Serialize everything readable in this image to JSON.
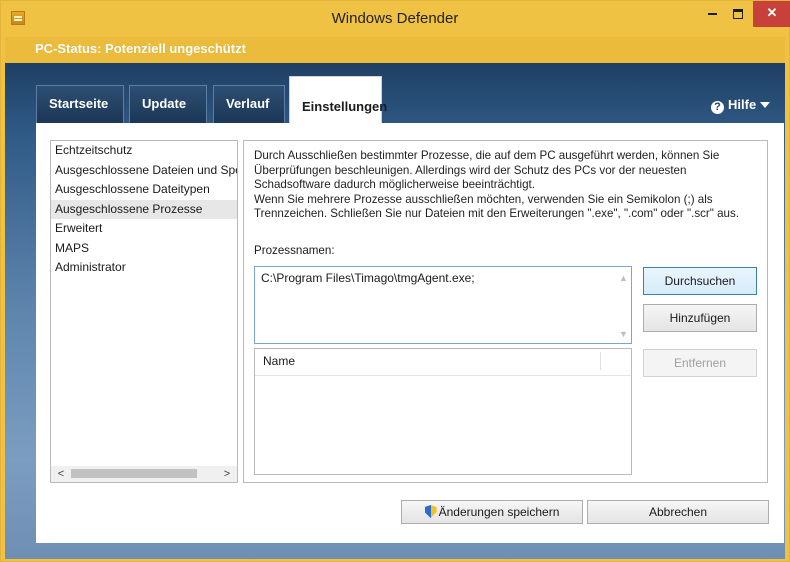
{
  "window": {
    "title": "Windows Defender"
  },
  "status": {
    "text": "PC-Status: Potenziell ungeschützt",
    "color": "#f0c243"
  },
  "tabs": [
    {
      "label": "Startseite"
    },
    {
      "label": "Update"
    },
    {
      "label": "Verlauf"
    },
    {
      "label": "Einstellungen",
      "selected": true
    }
  ],
  "help": {
    "label": "Hilfe",
    "icon": "question-circle-icon"
  },
  "nav": {
    "items": [
      {
        "label": "Echtzeitschutz"
      },
      {
        "label": "Ausgeschlossene Dateien und Speicherorte"
      },
      {
        "label": "Ausgeschlossene Dateitypen"
      },
      {
        "label": "Ausgeschlossene Prozesse",
        "selected": true
      },
      {
        "label": "Erweitert"
      },
      {
        "label": "MAPS"
      },
      {
        "label": "Administrator"
      }
    ]
  },
  "settings": {
    "description_1": "Durch Ausschließen bestimmter Prozesse, die auf dem PC ausgeführt werden, können Sie Überprüfungen beschleunigen. Allerdings wird der Schutz des PCs vor der neuesten Schadsoftware dadurch möglicherweise beeinträchtigt.",
    "description_2": "Wenn Sie mehrere Prozesse ausschließen möchten, verwenden Sie ein Semikolon (;) als Trennzeichen. Schließen Sie nur Dateien mit den Erweiterungen \".exe\", \".com\" oder \".scr\" aus.",
    "process_label": "Prozessnamen:",
    "process_value": "C:\\Program Files\\Timago\\tmgAgent.exe;",
    "list_header": "Name",
    "browse_label": "Durchsuchen",
    "add_label": "Hinzufügen",
    "remove_label": "Entfernen"
  },
  "footer": {
    "save_label": "Änderungen speichern",
    "cancel_label": "Abbrechen"
  }
}
